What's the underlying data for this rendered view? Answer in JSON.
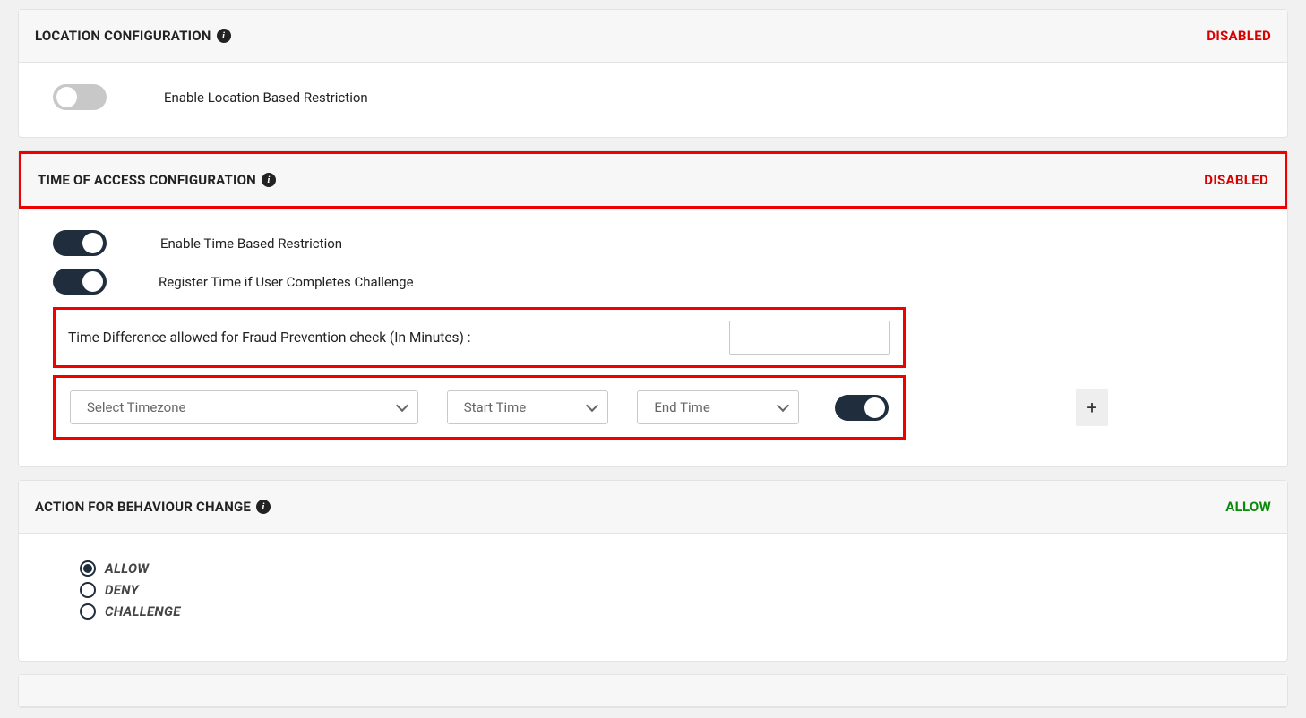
{
  "location_panel": {
    "title": "LOCATION CONFIGURATION",
    "status": "DISABLED",
    "toggle_label": "Enable Location Based Restriction"
  },
  "time_panel": {
    "title": "TIME OF ACCESS CONFIGURATION",
    "status": "DISABLED",
    "enable_label": "Enable Time Based Restriction",
    "register_label": "Register Time if User Completes Challenge",
    "fraud_label": "Time Difference allowed for Fraud Prevention check (In Minutes) :",
    "fraud_value": "",
    "timezone_placeholder": "Select Timezone",
    "start_placeholder": "Start Time",
    "end_placeholder": "End Time",
    "add_button": "+"
  },
  "action_panel": {
    "title": "ACTION FOR BEHAVIOUR CHANGE",
    "status": "ALLOW",
    "options": {
      "allow": "ALLOW",
      "deny": "DENY",
      "challenge": "CHALLENGE"
    }
  }
}
